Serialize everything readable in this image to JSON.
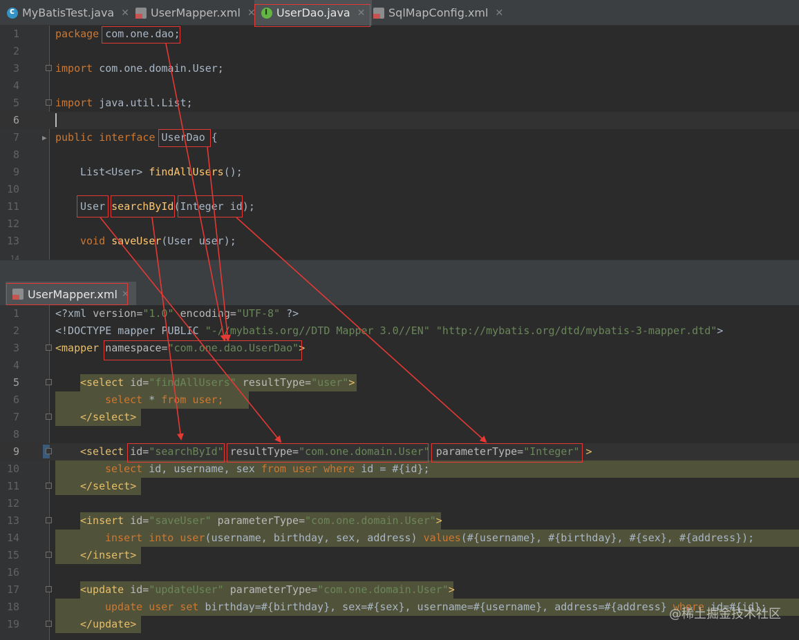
{
  "tabs": [
    {
      "label": "MyBatisTest.java",
      "icon": "java-class-icon"
    },
    {
      "label": "UserMapper.xml",
      "icon": "xml-file-icon"
    },
    {
      "label": "UserDao.java",
      "icon": "interface-icon",
      "active": true
    },
    {
      "label": "SqlMapConfig.xml",
      "icon": "xml-file-icon"
    }
  ],
  "java": {
    "line_numbers": [
      "1",
      "2",
      "3",
      "4",
      "5",
      "6",
      "7",
      "8",
      "9",
      "10",
      "11",
      "12",
      "13",
      "14"
    ],
    "l1": {
      "kw": "package",
      "pkg": "com.one.dao;"
    },
    "l3": {
      "kw": "import",
      "rest": "com.one.domain.User;"
    },
    "l5": {
      "kw": "import",
      "rest": "java.util.List;"
    },
    "l7": {
      "kw1": "public",
      "kw2": "interface",
      "name": "UserDao",
      "brace": "{"
    },
    "l9": {
      "type": "List<User>",
      "method": "findAllUsers",
      "rest": "();"
    },
    "l11": {
      "type": "User",
      "method": "searchById",
      "param": "(Integer id)",
      "semi": ";"
    },
    "l13": {
      "kw": "void",
      "method": "saveUser",
      "rest": "(User user);"
    }
  },
  "subtab": {
    "label": "UserMapper.xml"
  },
  "xml": {
    "line_numbers": [
      "1",
      "2",
      "3",
      "4",
      "5",
      "6",
      "7",
      "8",
      "9",
      "10",
      "11",
      "12",
      "13",
      "14",
      "15",
      "16",
      "17",
      "18",
      "19"
    ],
    "l1": {
      "a": "<?xml ",
      "b": "version=",
      "c": "\"1.0\"",
      "d": " encoding=",
      "e": "\"UTF-8\"",
      "f": " ?>"
    },
    "l2": {
      "a": "<!DOCTYPE mapper PUBLIC ",
      "b": "\"-//mybatis.org//DTD Mapper 3.0//EN\"",
      "c": " ",
      "d": "\"http://mybatis.org/dtd/mybatis-3-mapper.dtd\"",
      "e": ">"
    },
    "l3": {
      "a": "<mapper ",
      "b": "namespace=",
      "c": "\"com.one.dao.UserDao\"",
      "d": ">"
    },
    "l5": {
      "a": "<select ",
      "b": "id=",
      "c": "\"findAllUsers\"",
      "d": " resultType=",
      "e": "\"user\"",
      "f": ">"
    },
    "l6": {
      "a": "select",
      "b": " * ",
      "c": "from",
      "d": " ",
      "e": "user",
      "f": ";"
    },
    "l7": {
      "a": "</select>"
    },
    "l9": {
      "a": "<select ",
      "b": "id=",
      "c": "\"searchById\"",
      "d": " resultType=",
      "e": "\"com.one.domain.User\"",
      "f": " parameterType=",
      "g": "\"Integer\"",
      "h": " >"
    },
    "l10": {
      "a": "select",
      "b": " id, username, sex ",
      "c": "from",
      "d": " ",
      "e": "user",
      "f": " ",
      "g": "where",
      "h": " id = #{id};"
    },
    "l11": {
      "a": "</select>"
    },
    "l13": {
      "a": "<insert ",
      "b": "id=",
      "c": "\"saveUser\"",
      "d": " parameterType=",
      "e": "\"com.one.domain.User\"",
      "f": ">"
    },
    "l14": {
      "a": "insert into",
      "b": " ",
      "c": "user",
      "d": "(username, birthday, sex, address) ",
      "e": "values",
      "f": "(#{username}, #{birthday}, #{sex}, #{address});"
    },
    "l15": {
      "a": "</insert>"
    },
    "l17": {
      "a": "<update ",
      "b": "id=",
      "c": "\"updateUser\"",
      "d": " parameterType=",
      "e": "\"com.one.domain.User\"",
      "f": ">"
    },
    "l18": {
      "a": "update",
      "b": " ",
      "c": "user",
      "d": " ",
      "e": "set",
      "f": " birthday=#{birthday}, sex=#{sex}, username=#{username}, address=#{address} ",
      "g": "where",
      "h": " id=#{id};"
    },
    "l19": {
      "a": "</update>"
    }
  },
  "watermark": "@稀土掘金技术社区",
  "colors": {
    "annotation": "#e53935",
    "keyword": "#cc7832",
    "string": "#6a8759",
    "tag": "#e8bf6a",
    "method": "#ffc66d"
  }
}
